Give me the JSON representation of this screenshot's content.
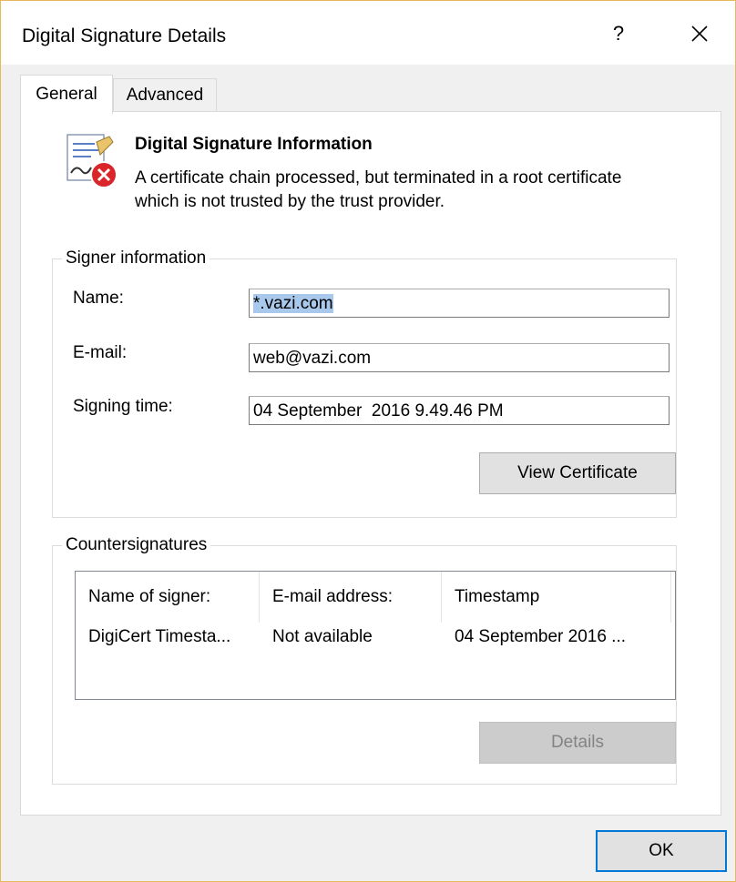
{
  "window": {
    "title": "Digital Signature Details",
    "help_label": "?",
    "close_icon": "close-icon"
  },
  "tabs": [
    {
      "label": "General",
      "selected": true
    },
    {
      "label": "Advanced",
      "selected": false
    }
  ],
  "info": {
    "icon": "certificate-error-icon",
    "heading": "Digital Signature Information",
    "text": "A certificate chain processed, but terminated in a root certificate which is not trusted by the trust provider."
  },
  "signer": {
    "legend": "Signer information",
    "name_label": "Name:",
    "name_value": "*.vazi.com",
    "email_label": "E-mail:",
    "email_value": "web@vazi.com",
    "time_label": "Signing time:",
    "time_value": "04 September  2016 9.49.46 PM",
    "view_certificate_label": "View Certificate"
  },
  "countersignatures": {
    "legend": "Countersignatures",
    "columns": [
      "Name of signer:",
      "E-mail address:",
      "Timestamp"
    ],
    "rows": [
      [
        "DigiCert Timesta...",
        "Not available",
        "04 September 2016 ..."
      ]
    ],
    "details_label": "Details"
  },
  "footer": {
    "ok_label": "OK"
  },
  "colors": {
    "accent": "#0078d7",
    "selection": "#a8c8ec",
    "error": "#d9262b"
  }
}
